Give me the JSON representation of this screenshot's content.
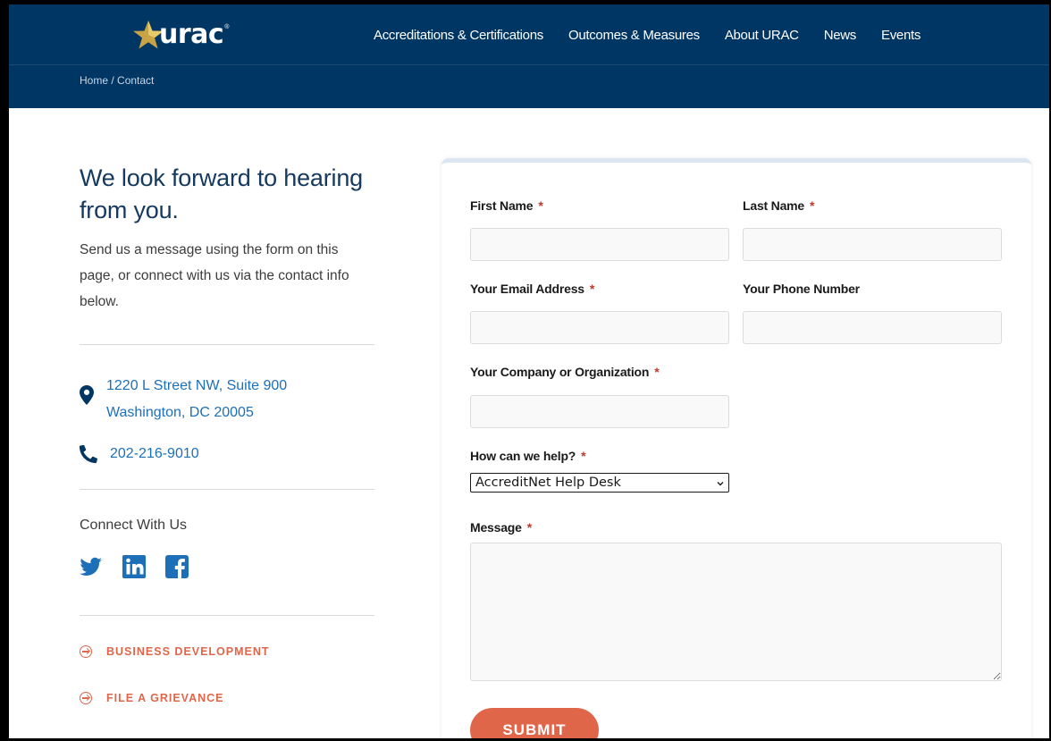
{
  "header": {
    "logo_text": "urac",
    "logo_reg": "®",
    "nav": [
      {
        "label": "Accreditations & Certifications"
      },
      {
        "label": "Outcomes & Measures"
      },
      {
        "label": "About URAC"
      },
      {
        "label": "News"
      },
      {
        "label": "Events"
      }
    ],
    "breadcrumb": {
      "home": "Home",
      "sep": " / ",
      "current": "Contact"
    }
  },
  "intro": {
    "headline": "We look forward to hearing from you.",
    "text": "Send us a message using the form on this page, or connect with us via the contact info below."
  },
  "contact": {
    "address_line1": "1220 L Street NW, Suite 900",
    "address_line2": "Washington, DC 20005",
    "phone": "202-216-9010",
    "connect_label": "Connect With Us",
    "social": [
      "twitter-icon",
      "linkedin-icon",
      "facebook-icon"
    ]
  },
  "ctas": [
    {
      "label": "BUSINESS DEVELOPMENT"
    },
    {
      "label": "FILE A GRIEVANCE"
    }
  ],
  "form": {
    "required_mark": "*",
    "first_name_label": "First Name",
    "last_name_label": "Last Name",
    "email_label": "Your Email Address",
    "phone_label": "Your Phone Number",
    "company_label": "Your Company or Organization",
    "help_label": "How can we help?",
    "help_selected": "AccreditNet Help Desk",
    "message_label": "Message",
    "submit_label": "SUBMIT"
  },
  "colors": {
    "header_bg": "#003663",
    "link_blue": "#1d6fb8",
    "accent_orange": "#e0664a",
    "required_red": "#c0392b"
  }
}
